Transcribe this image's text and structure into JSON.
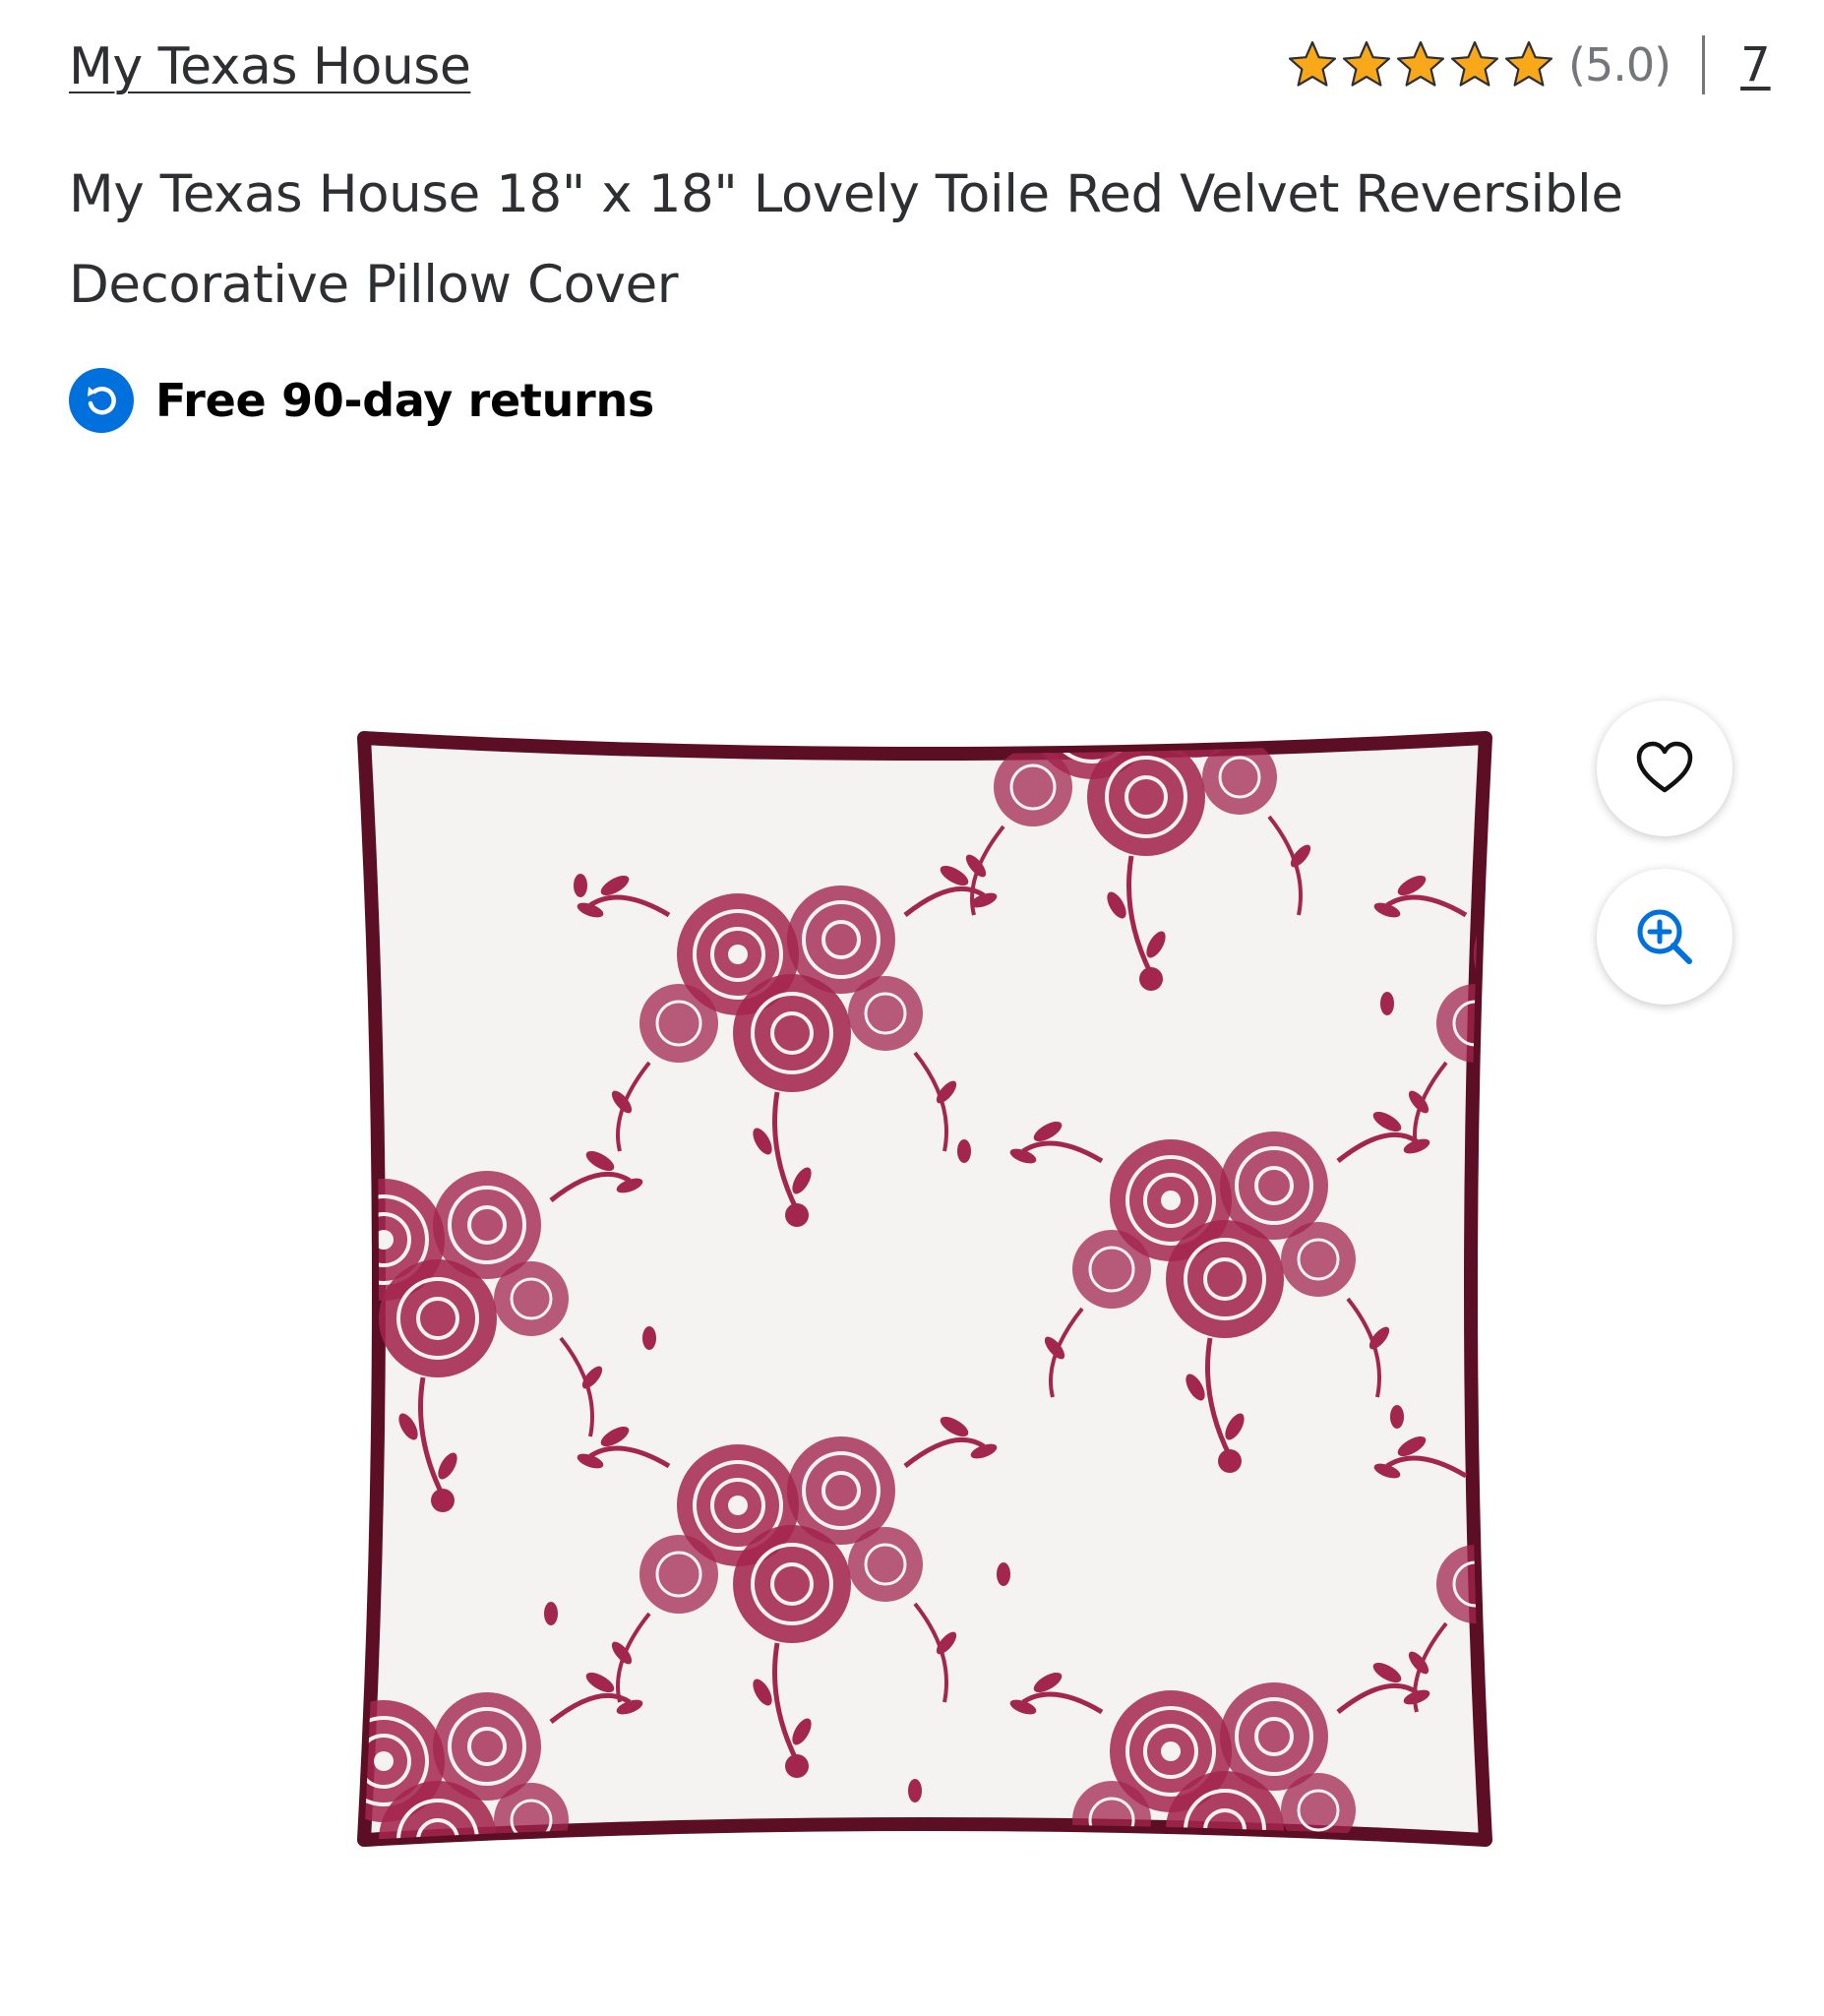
{
  "header": {
    "brand": "My Texas House",
    "rating": {
      "stars": 5,
      "max_stars": 5,
      "value_label": "(5.0)",
      "review_count": "7",
      "star_color": "#f9a81a"
    }
  },
  "product": {
    "title": "My Texas House 18\" x 18\" Lovely Toile Red Velvet Reversible Decorative Pillow Cover"
  },
  "returns": {
    "label": "Free 90-day returns",
    "icon": "returns-icon",
    "icon_color": "#0071dc"
  },
  "image": {
    "alt": "My Texas House 18\" x 18\" Lovely Toile Red Velvet Reversible Decorative Pillow Cover",
    "pattern_color": "#a3264f",
    "piping_color": "#5c0f24",
    "fabric_color": "#f4f3f2"
  },
  "actions": {
    "favorite_icon": "heart-icon",
    "zoom_icon": "zoom-in-icon",
    "icon_color": "#0071dc"
  }
}
